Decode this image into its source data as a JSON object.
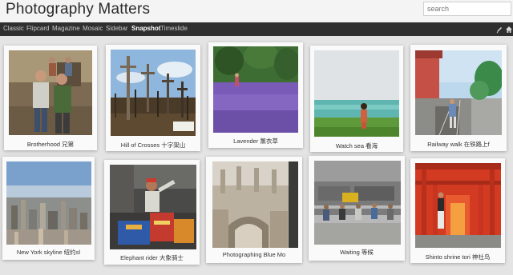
{
  "header": {
    "title": "Photography Matters",
    "search_placeholder": "search"
  },
  "nav": {
    "items": [
      {
        "label": "Classic"
      },
      {
        "label": "Flipcard"
      },
      {
        "label": "Magazine"
      },
      {
        "label": "Mosaic"
      },
      {
        "label": "Sidebar"
      },
      {
        "label": "Snapshot"
      },
      {
        "label": "Timeslide"
      }
    ],
    "active": "Snapshot",
    "icons": [
      "pencil-icon",
      "home-icon"
    ]
  },
  "photos": [
    {
      "caption": "Brotherhood 兄第"
    },
    {
      "caption": "Hill of Crosses 十字架山"
    },
    {
      "caption": "Lavender 薰衣草"
    },
    {
      "caption": "Watch sea 看海"
    },
    {
      "caption": "Railway walk 在铁路上f"
    },
    {
      "caption": "New York skyline 纽约sl"
    },
    {
      "caption": "Elephant rider 大象骑士"
    },
    {
      "caption": "Photographing Blue Mo"
    },
    {
      "caption": "Waiting 等候"
    },
    {
      "caption": "Shinto shrine tori 神社鸟"
    }
  ]
}
